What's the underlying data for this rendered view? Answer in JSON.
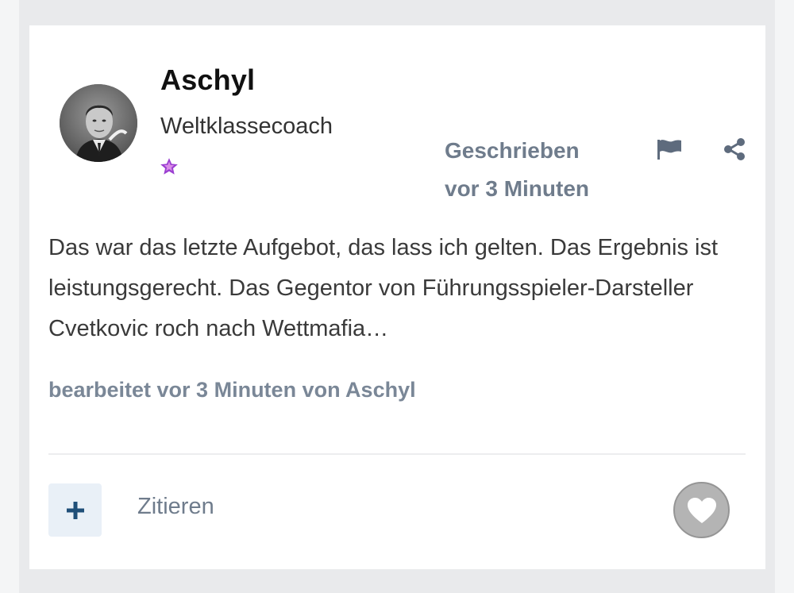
{
  "post": {
    "author": {
      "name": "Aschyl",
      "rank_title": "Weltklassecoach",
      "avatar_icon": "user-avatar-photo",
      "rank_icon": "star-icon",
      "rank_icon_color": "#9b3fd1"
    },
    "meta": {
      "date_line1": "Geschrieben",
      "date_line2": "vor 3 Minuten",
      "report_icon": "flag-icon",
      "share_icon": "share-icon"
    },
    "content": "Das war das letzte Aufgebot, das lass ich gelten. Das Ergebnis ist leistungsgerecht. Das Gegentor von Führungsspieler-Darsteller Cvetkovic roch nach Wettmafia…",
    "edit_note": "bearbeitet vor 3 Minuten von Aschyl",
    "actions": {
      "multiquote_icon": "plus-icon",
      "quote_label": "Zitieren",
      "like_icon": "heart-icon"
    }
  },
  "colors": {
    "accent": "#1f4f78",
    "meta_text": "#6f7c8c",
    "like_bg": "#b4b4b4"
  }
}
